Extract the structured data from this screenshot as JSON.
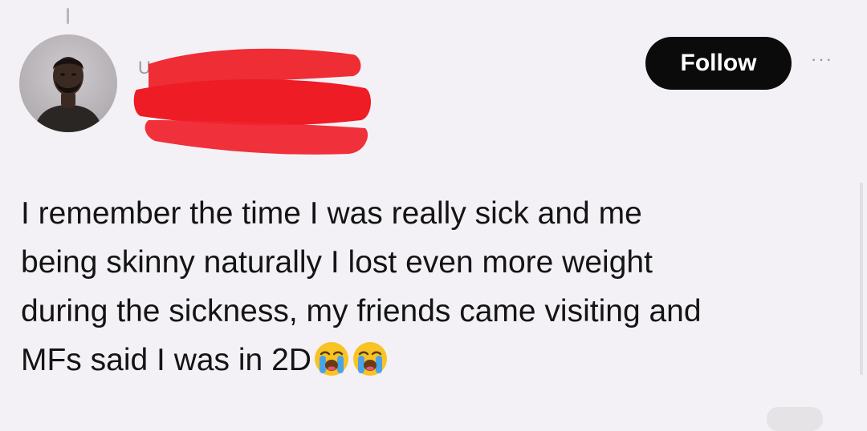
{
  "post": {
    "author": {
      "avatar_icon": "profile-photo",
      "name_redacted": true
    },
    "follow_label": "Follow",
    "more_icon": "more-horizontal-icon",
    "text_lines": [
      "I remember the time I was really sick and me",
      "being skinny naturally I lost even more weight",
      "during the sickness, my friends came visiting and",
      "MFs said I was in 2D"
    ],
    "emojis": [
      "loudly-crying-face",
      "loudly-crying-face"
    ]
  },
  "colors": {
    "background": "#f3f1f5",
    "follow_button": "#0b0b0b",
    "follow_text": "#ffffff",
    "redaction": "#ee1c24",
    "text": "#141414"
  }
}
